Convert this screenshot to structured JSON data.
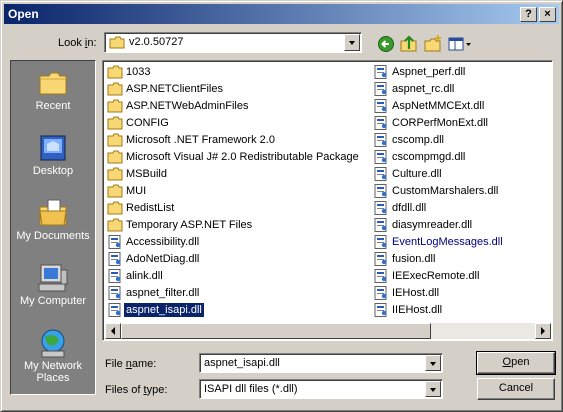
{
  "window": {
    "title": "Open",
    "help_glyph": "?",
    "close_glyph": "×"
  },
  "look_in": {
    "label_prefix": "Look ",
    "label_accel": "i",
    "label_suffix": "n:",
    "value": "v2.0.50727"
  },
  "places": [
    {
      "label": "Recent",
      "icon": "recent-icon"
    },
    {
      "label": "Desktop",
      "icon": "desktop-icon"
    },
    {
      "label": "My Documents",
      "icon": "my-documents-icon"
    },
    {
      "label": "My Computer",
      "icon": "my-computer-icon"
    },
    {
      "label": "My Network Places",
      "icon": "network-places-icon"
    }
  ],
  "files": {
    "col1": [
      {
        "name": "1033",
        "type": "folder"
      },
      {
        "name": "ASP.NETClientFiles",
        "type": "folder"
      },
      {
        "name": "ASP.NETWebAdminFiles",
        "type": "folder"
      },
      {
        "name": "CONFIG",
        "type": "folder"
      },
      {
        "name": "Microsoft .NET Framework 2.0",
        "type": "folder"
      },
      {
        "name": "Microsoft Visual J# 2.0 Redistributable Package",
        "type": "folder"
      },
      {
        "name": "MSBuild",
        "type": "folder"
      },
      {
        "name": "MUI",
        "type": "folder"
      },
      {
        "name": "RedistList",
        "type": "folder"
      },
      {
        "name": "Temporary ASP.NET Files",
        "type": "folder"
      },
      {
        "name": "Accessibility.dll",
        "type": "dll"
      },
      {
        "name": "AdoNetDiag.dll",
        "type": "dll"
      },
      {
        "name": "alink.dll",
        "type": "dll"
      },
      {
        "name": "aspnet_filter.dll",
        "type": "dll"
      },
      {
        "name": "aspnet_isapi.dll",
        "type": "dll",
        "selected": true
      }
    ],
    "col2": [
      {
        "name": "Aspnet_perf.dll",
        "type": "dll"
      },
      {
        "name": "aspnet_rc.dll",
        "type": "dll"
      },
      {
        "name": "AspNetMMCExt.dll",
        "type": "dll"
      },
      {
        "name": "CORPerfMonExt.dll",
        "type": "dll"
      },
      {
        "name": "cscomp.dll",
        "type": "dll"
      },
      {
        "name": "cscompmgd.dll",
        "type": "dll"
      },
      {
        "name": "Culture.dll",
        "type": "dll"
      },
      {
        "name": "CustomMarshalers.dll",
        "type": "dll"
      },
      {
        "name": "dfdll.dll",
        "type": "dll"
      },
      {
        "name": "diasymreader.dll",
        "type": "dll"
      },
      {
        "name": "EventLogMessages.dll",
        "type": "dll",
        "blue": true
      },
      {
        "name": "fusion.dll",
        "type": "dll"
      },
      {
        "name": "IEExecRemote.dll",
        "type": "dll"
      },
      {
        "name": "IEHost.dll",
        "type": "dll"
      },
      {
        "name": "IIEHost.dll",
        "type": "dll"
      }
    ]
  },
  "file_name": {
    "label_prefix": "File ",
    "label_accel": "n",
    "label_suffix": "ame:",
    "value": "aspnet_isapi.dll"
  },
  "file_type": {
    "label_prefix": "Files of ",
    "label_accel": "t",
    "label_suffix": "ype:",
    "value": "ISAPI dll files (*.dll)"
  },
  "buttons": {
    "open_accel": "O",
    "open_rest": "pen",
    "cancel": "Cancel"
  }
}
